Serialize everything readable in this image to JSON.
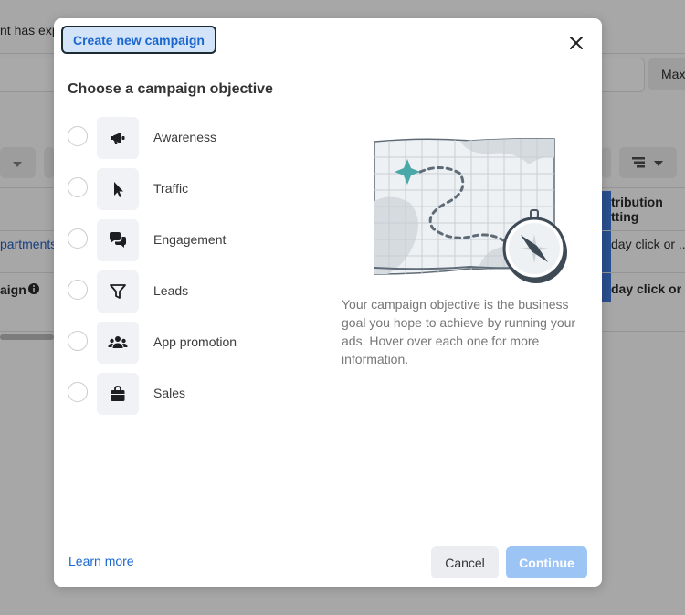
{
  "background": {
    "notice_text": "nt has exp",
    "max_button": "Max",
    "attribution_header_line1": "tribution",
    "attribution_header_line2": "tting",
    "row1_name": "partments",
    "row1_attribution": "day click or ...",
    "row2_name": "aign",
    "row2_attribution": "day click or ..."
  },
  "modal": {
    "tab_title": "Create new campaign",
    "heading": "Choose a campaign objective",
    "options": [
      {
        "label": "Awareness",
        "icon": "megaphone-icon"
      },
      {
        "label": "Traffic",
        "icon": "cursor-icon"
      },
      {
        "label": "Engagement",
        "icon": "chat-bubbles-icon"
      },
      {
        "label": "Leads",
        "icon": "funnel-icon"
      },
      {
        "label": "App promotion",
        "icon": "people-icon"
      },
      {
        "label": "Sales",
        "icon": "shopping-bag-icon"
      }
    ],
    "description": "Your campaign objective is the business goal you hope to achieve by running your ads. Hover over each one for more information.",
    "learn_more": "Learn more",
    "cancel": "Cancel",
    "continue": "Continue"
  },
  "colors": {
    "accent": "#1a67cf",
    "continue_disabled": "#9cc4f5",
    "teal_star": "#4aa8a8"
  }
}
